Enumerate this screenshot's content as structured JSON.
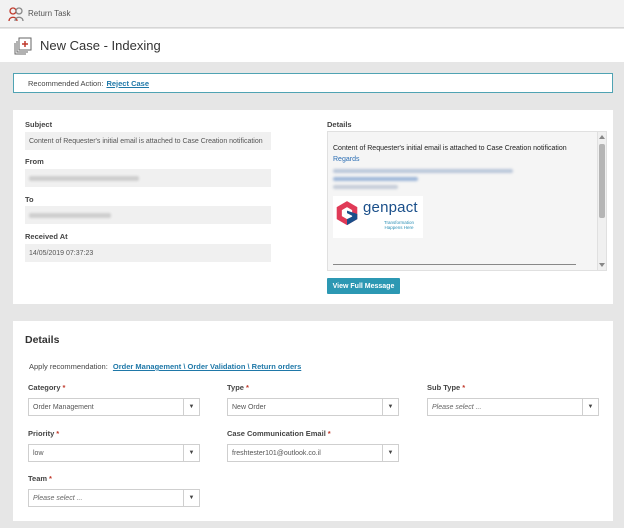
{
  "topbar": {
    "return_label": "Return Task"
  },
  "header": {
    "title": "New Case - Indexing"
  },
  "recommended": {
    "label": "Recommended Action:",
    "action": "Reject Case"
  },
  "email": {
    "subject_label": "Subject",
    "subject_value": "Content of Requester's initial email is attached to Case Creation notification",
    "from_label": "From",
    "to_label": "To",
    "received_label": "Received At",
    "received_value": "14/05/2019 07:37:23",
    "details_label": "Details",
    "details_text": "Content of Requester's initial email is attached to Case Creation notification",
    "details_regards": "Regards",
    "logo_text": "genpact",
    "logo_tagline": "Transformation Happens Here",
    "view_full_message": "View Full Message"
  },
  "details": {
    "title": "Details",
    "apply_label": "Apply recommendation:",
    "apply_link": "Order Management \\ Order Validation \\ Return orders",
    "category": {
      "label": "Category",
      "value": "Order Management"
    },
    "type": {
      "label": "Type",
      "value": "New Order"
    },
    "subtype": {
      "label": "Sub Type",
      "placeholder": "Please select ..."
    },
    "priority": {
      "label": "Priority",
      "value": "low"
    },
    "comm_email": {
      "label": "Case Communication Email",
      "value": "freshtester101@outlook.co.il"
    },
    "team": {
      "label": "Team",
      "placeholder": "Please select ..."
    },
    "required_marker": "*"
  },
  "colors": {
    "accent": "#2c98b3",
    "link": "#1f78a8",
    "required": "#c0392b",
    "brand": "#1a4f8a"
  }
}
